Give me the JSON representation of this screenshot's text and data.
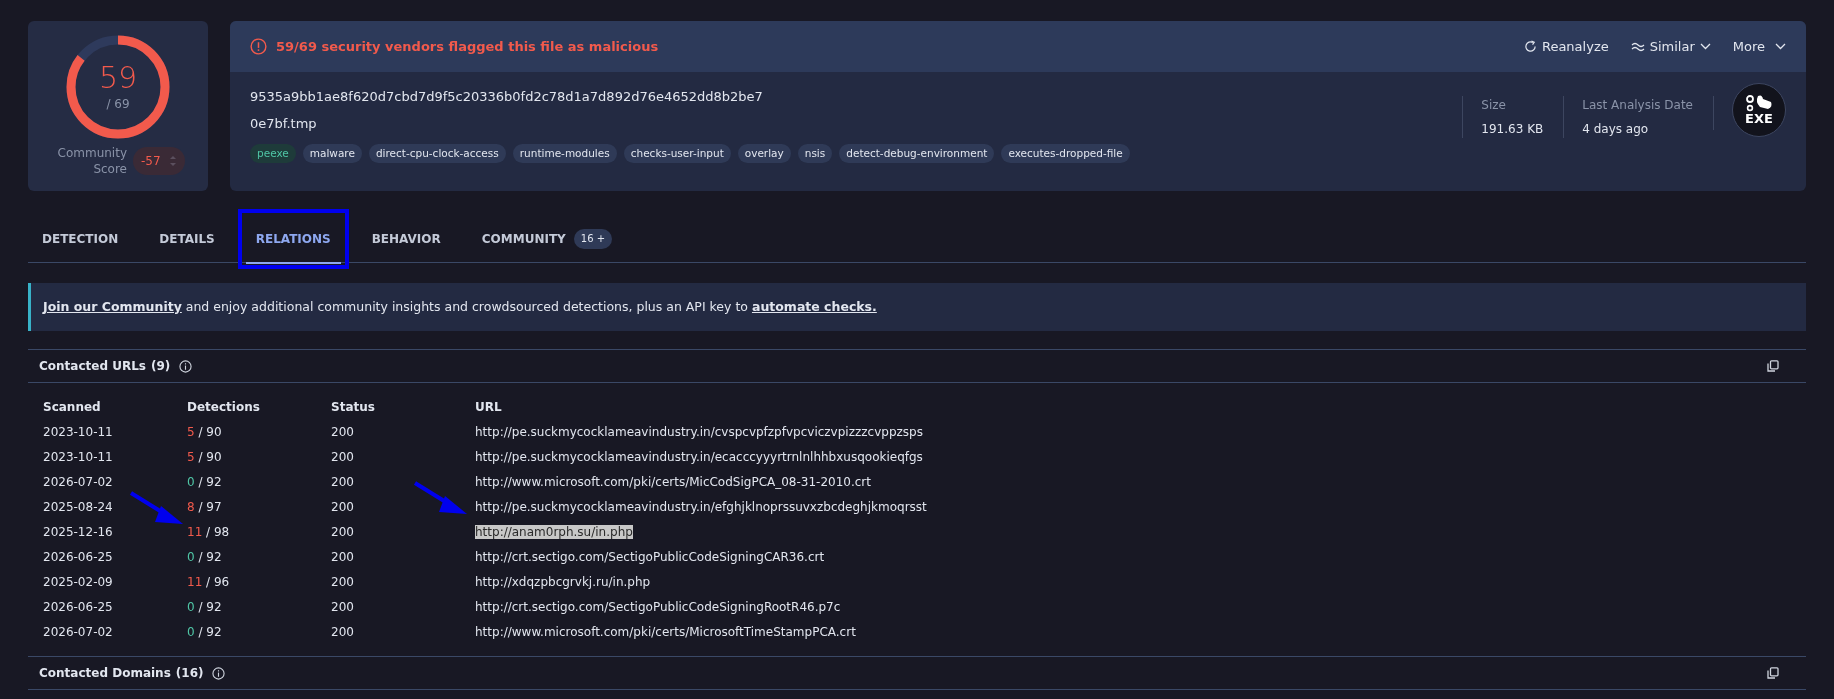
{
  "score": {
    "detected": "59",
    "total": "/ 69",
    "level": 0.855,
    "community_label": "Community Score",
    "community_score": "-57"
  },
  "alert": "59/69 security vendors flagged this file as malicious",
  "actions": [
    {
      "kind": "reanalyze",
      "label": "Reanalyze"
    },
    {
      "kind": "similar",
      "label": "Similar"
    },
    {
      "kind": "more",
      "label": "More"
    }
  ],
  "file": {
    "hash": "9535a9bb1ae8f620d7cbd7d9f5c20336b0fd2c78d1a7d892d76e4652dd8b2be7",
    "name": "0e7bf.tmp",
    "type_icon": "EXE",
    "tags": [
      {
        "label": "peexe",
        "kind": "type"
      },
      {
        "label": "malware",
        "kind": "tag"
      },
      {
        "label": "direct-cpu-clock-access",
        "kind": "tag"
      },
      {
        "label": "runtime-modules",
        "kind": "tag"
      },
      {
        "label": "checks-user-input",
        "kind": "tag"
      },
      {
        "label": "overlay",
        "kind": "tag"
      },
      {
        "label": "nsis",
        "kind": "tag"
      },
      {
        "label": "detect-debug-environment",
        "kind": "tag"
      },
      {
        "label": "executes-dropped-file",
        "kind": "tag"
      }
    ],
    "stats": [
      {
        "label": "Size",
        "value": "191.63 KB"
      },
      {
        "label": "Last Analysis Date",
        "value": "4 days ago"
      }
    ]
  },
  "tabs": [
    {
      "label": "DETECTION",
      "selected": false,
      "outlined": false
    },
    {
      "label": "DETAILS",
      "selected": false,
      "outlined": false
    },
    {
      "label": "RELATIONS",
      "selected": true,
      "outlined": true
    },
    {
      "label": "BEHAVIOR",
      "selected": false,
      "outlined": false
    },
    {
      "label": "COMMUNITY",
      "selected": false,
      "outlined": false,
      "badge": "16 +"
    }
  ],
  "banner": {
    "link1": "Join our Community",
    "text": " and enjoy additional community insights and crowdsourced detections, plus an API key to ",
    "link2": "automate checks."
  },
  "contacted_urls": {
    "title": "Contacted URLs",
    "count": "(9)",
    "columns": [
      "Scanned",
      "Detections",
      "Status",
      "URL"
    ],
    "rows": [
      {
        "scanned": "2023-10-11",
        "detections": "5",
        "total": "/ 90",
        "malicious": true,
        "status": "200",
        "url": "http://pe.suckmycocklameavindustry.in/cvspcvpfzpfvpcviczvpizzzcvppzsps",
        "highlighted": false,
        "arrowed": false
      },
      {
        "scanned": "2023-10-11",
        "detections": "5",
        "total": "/ 90",
        "malicious": true,
        "status": "200",
        "url": "http://pe.suckmycocklameavindustry.in/ecacccyyyrtrnlnlhhbxusqookieqfgs",
        "highlighted": false,
        "arrowed": false
      },
      {
        "scanned": "2026-07-02",
        "detections": "0",
        "total": "/ 92",
        "malicious": false,
        "status": "200",
        "url": "http://www.microsoft.com/pki/certs/MicCodSigPCA_08-31-2010.crt",
        "highlighted": false,
        "arrowed": false
      },
      {
        "scanned": "2025-08-24",
        "detections": "8",
        "total": "/ 97",
        "malicious": true,
        "status": "200",
        "url": "http://pe.suckmycocklameavindustry.in/efghjklnoprssuvxzbcdeghjkmoqrsst",
        "highlighted": false,
        "arrowed": false
      },
      {
        "scanned": "2025-12-16",
        "detections": "11",
        "total": "/ 98",
        "malicious": true,
        "status": "200",
        "url": "http://anam0rph.su/in.php",
        "highlighted": true,
        "arrowed": true
      },
      {
        "scanned": "2026-06-25",
        "detections": "0",
        "total": "/ 92",
        "malicious": false,
        "status": "200",
        "url": "http://crt.sectigo.com/SectigoPublicCodeSigningCAR36.crt",
        "highlighted": false,
        "arrowed": false
      },
      {
        "scanned": "2025-02-09",
        "detections": "11",
        "total": "/ 96",
        "malicious": true,
        "status": "200",
        "url": "http://xdqzpbcgrvkj.ru/in.php",
        "highlighted": false,
        "arrowed": false
      },
      {
        "scanned": "2026-06-25",
        "detections": "0",
        "total": "/ 92",
        "malicious": false,
        "status": "200",
        "url": "http://crt.sectigo.com/SectigoPublicCodeSigningRootR46.p7c",
        "highlighted": false,
        "arrowed": false
      },
      {
        "scanned": "2026-07-02",
        "detections": "0",
        "total": "/ 92",
        "malicious": false,
        "status": "200",
        "url": "http://www.microsoft.com/pki/certs/MicrosoftTimeStampPCA.crt",
        "highlighted": false,
        "arrowed": false
      }
    ]
  },
  "contacted_domains": {
    "title": "Contacted Domains",
    "count": "(16)"
  }
}
